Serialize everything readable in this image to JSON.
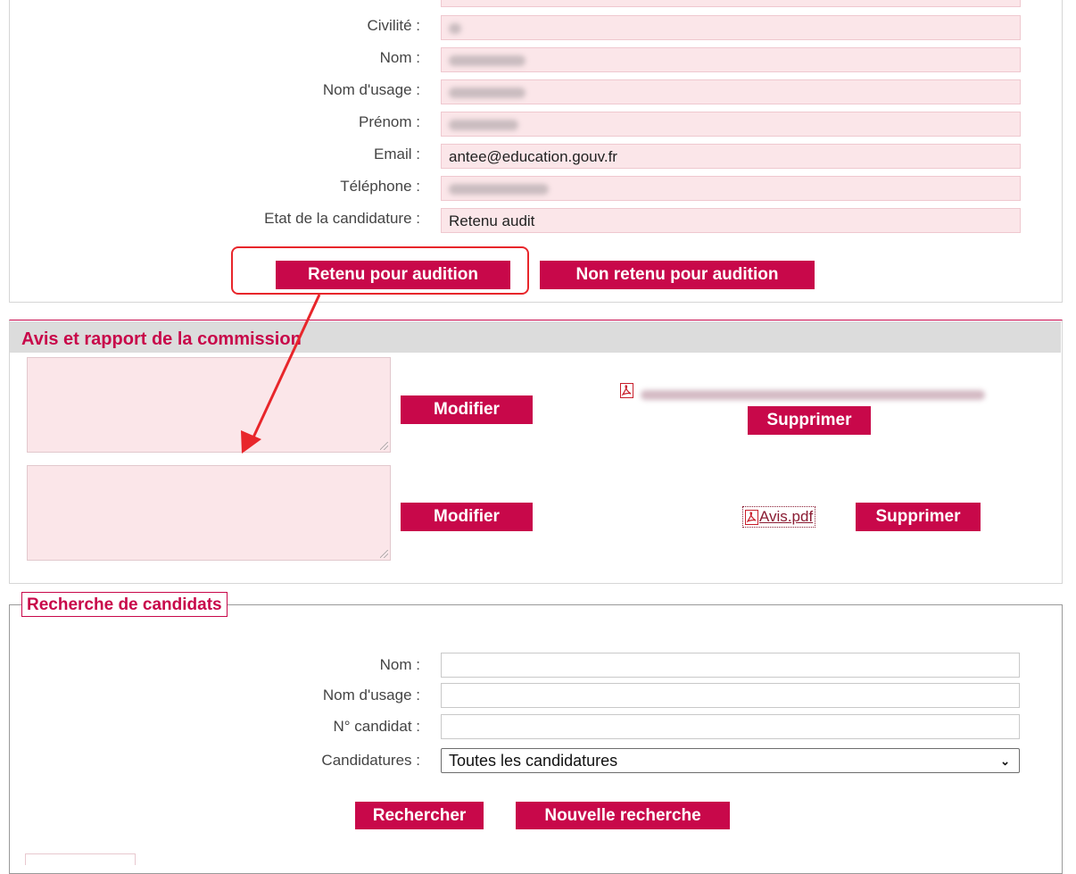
{
  "candidate": {
    "fields": [
      {
        "label": "Civilité :",
        "value": ""
      },
      {
        "label": "Nom :",
        "value": ""
      },
      {
        "label": "Nom d'usage :",
        "value": ""
      },
      {
        "label": "Prénom :",
        "value": ""
      },
      {
        "label": "Email :",
        "value": "antee@education.gouv.fr"
      },
      {
        "label": "Téléphone :",
        "value": ""
      },
      {
        "label": "Etat de la candidature :",
        "value": "Retenu audit"
      }
    ],
    "btn_retenu": "Retenu pour audition",
    "btn_non_retenu": "Non retenu pour audition"
  },
  "commission": {
    "title": "Avis et rapport de la commission",
    "row1": {
      "modify_label": "Modifier",
      "delete_label": "Supprimer",
      "file_name": ""
    },
    "row2": {
      "modify_label": "Modifier",
      "delete_label": "Supprimer",
      "file_name": "Avis.pdf"
    }
  },
  "search": {
    "legend": "Recherche de candidats",
    "fields": [
      {
        "label": "Nom :",
        "value": ""
      },
      {
        "label": "Nom d'usage :",
        "value": ""
      },
      {
        "label": "N° candidat :",
        "value": ""
      }
    ],
    "candidatures_label": "Candidatures :",
    "candidatures_selected": "Toutes les candidatures",
    "search_button": "Rechercher",
    "new_search_button": "Nouvelle recherche"
  },
  "colors": {
    "accent": "#c8084a",
    "field_bg": "#fbe6e9",
    "annotation": "#e8262b"
  }
}
